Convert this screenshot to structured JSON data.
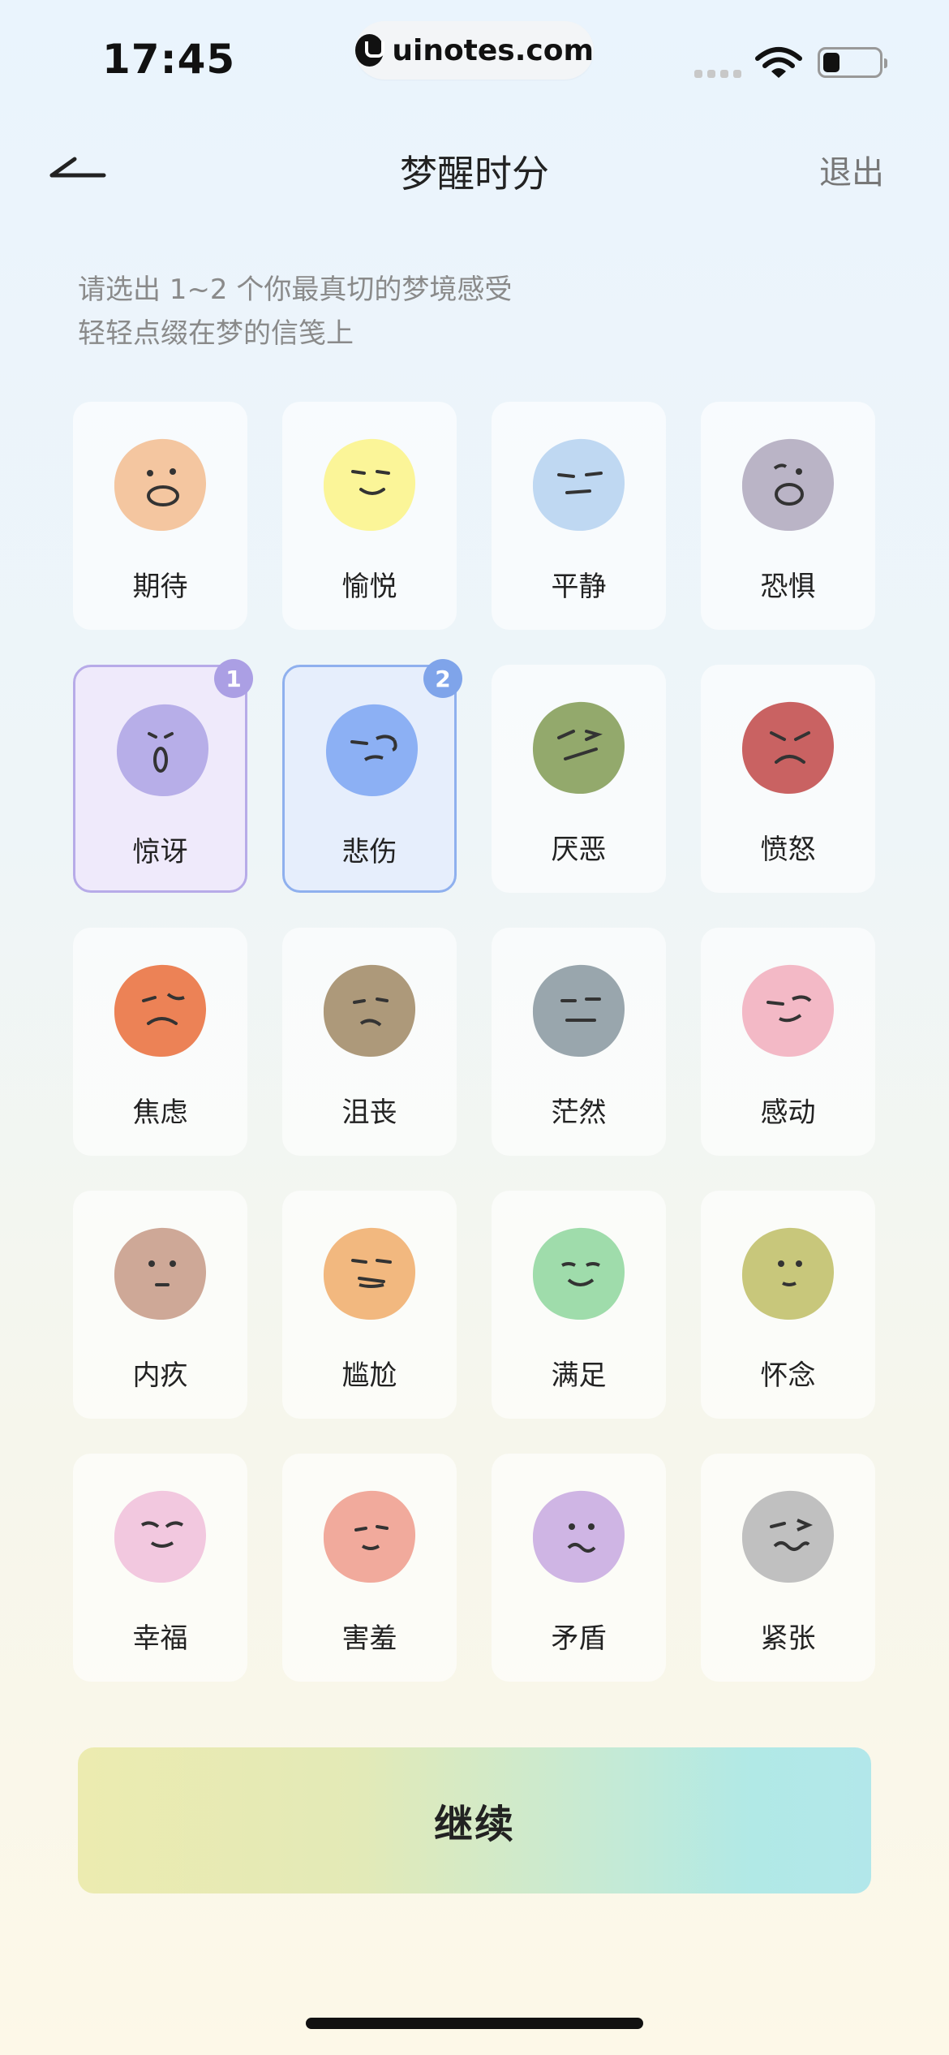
{
  "status_bar": {
    "time": "17:45",
    "url": "uinotes.com"
  },
  "nav": {
    "title": "梦醒时分",
    "exit_label": "退出"
  },
  "prompt": {
    "line1": "请选出 1~2 个你最真切的梦境感受",
    "line2": "轻轻点缀在梦的信笺上"
  },
  "emotions": [
    {
      "label": "期待",
      "color": "#f4c6a0",
      "icon": "eager-face-icon"
    },
    {
      "label": "愉悦",
      "color": "#fbf598",
      "icon": "pleased-face-icon"
    },
    {
      "label": "平静",
      "color": "#bfd8f2",
      "icon": "calm-face-icon"
    },
    {
      "label": "恐惧",
      "color": "#bab4c6",
      "icon": "fear-face-icon"
    },
    {
      "label": "惊讶",
      "color": "#b7aee8",
      "icon": "surprise-face-icon",
      "selected": true,
      "order": "1"
    },
    {
      "label": "悲伤",
      "color": "#8cb0f4",
      "icon": "sad-face-icon",
      "selected": true,
      "order": "2"
    },
    {
      "label": "厌恶",
      "color": "#93a96c",
      "icon": "disgust-face-icon"
    },
    {
      "label": "愤怒",
      "color": "#c96262",
      "icon": "angry-face-icon"
    },
    {
      "label": "焦虑",
      "color": "#ec8256",
      "icon": "anxious-face-icon"
    },
    {
      "label": "沮丧",
      "color": "#ad997a",
      "icon": "dejected-face-icon"
    },
    {
      "label": "茫然",
      "color": "#99a6ad",
      "icon": "blank-face-icon"
    },
    {
      "label": "感动",
      "color": "#f3b9c6",
      "icon": "touched-face-icon"
    },
    {
      "label": "内疚",
      "color": "#cea897",
      "icon": "guilty-face-icon"
    },
    {
      "label": "尴尬",
      "color": "#f2b87f",
      "icon": "awkward-face-icon"
    },
    {
      "label": "满足",
      "color": "#9fdcab",
      "icon": "content-face-icon"
    },
    {
      "label": "怀念",
      "color": "#c8c77b",
      "icon": "nostalgic-face-icon"
    },
    {
      "label": "幸福",
      "color": "#f2c8df",
      "icon": "happy-face-icon"
    },
    {
      "label": "害羞",
      "color": "#f1aa9c",
      "icon": "shy-face-icon"
    },
    {
      "label": "矛盾",
      "color": "#cfb5e4",
      "icon": "conflicted-face-icon"
    },
    {
      "label": "紧张",
      "color": "#c0c0c0",
      "icon": "nervous-face-icon"
    }
  ],
  "continue_label": "继续"
}
